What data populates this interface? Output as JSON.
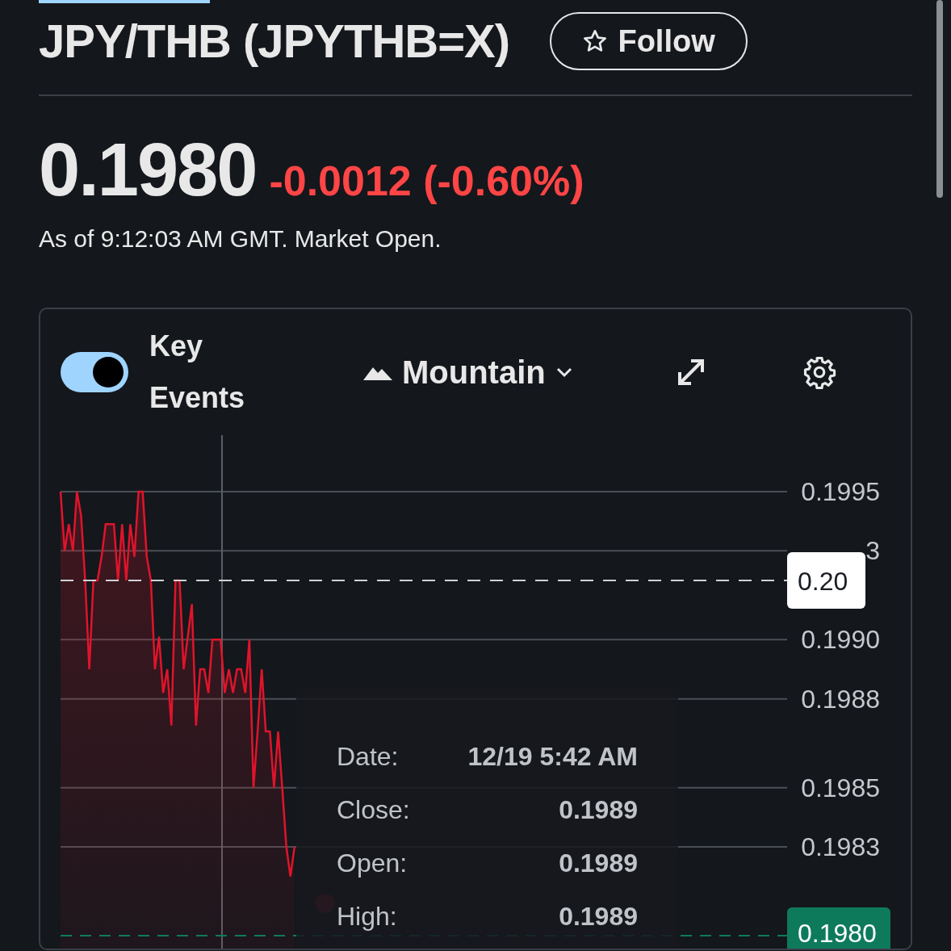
{
  "header": {
    "title": "JPY/THB (JPYTHB=X)",
    "follow_button": "Follow"
  },
  "quote": {
    "price": "0.1980",
    "change": "-0.0012 (-0.60%)",
    "timestamp": "As of 9:12:03 AM GMT. Market Open."
  },
  "chart_controls": {
    "key_events": {
      "label": "Key Events",
      "on": true
    },
    "chart_type": "Mountain"
  },
  "chart": {
    "covered_tick_fragment": "3",
    "chart_data": {
      "type": "area",
      "grid": true,
      "ylim": [
        0.198,
        0.1995
      ],
      "yticks": [
        0.1995,
        {
          "value": 0.199,
          "label": "0.1990"
        },
        0.1988,
        0.1985,
        0.1983
      ],
      "series": [
        {
          "color": "#e0142b",
          "values": [
            0.1995,
            0.1993,
            0.19939,
            0.1993,
            0.1995,
            0.19942,
            0.1992,
            0.1989,
            0.1992,
            0.1992,
            0.19928,
            0.19939,
            0.19939,
            0.19939,
            0.1992,
            0.19939,
            0.1992,
            0.19939,
            0.19928,
            0.1995,
            0.1995,
            0.19928,
            0.1992,
            0.1989,
            0.19901,
            0.19882,
            0.1989,
            0.19871,
            0.1992,
            0.1992,
            0.1989,
            0.19901,
            0.19912,
            0.19871,
            0.1989,
            0.1989,
            0.19882,
            0.199,
            0.199,
            0.199,
            0.19882,
            0.1989,
            0.19882,
            0.1989,
            0.1989,
            0.19882,
            0.199,
            0.1985,
            0.19869,
            0.1989,
            0.19869,
            0.19869,
            0.1985,
            0.19869,
            0.1985,
            0.1983,
            0.1982,
            0.1983,
            null,
            null,
            null,
            null,
            null,
            null,
            null,
            null,
            null,
            null,
            null,
            null,
            null,
            null,
            null,
            null,
            null,
            null,
            null,
            null,
            null,
            null,
            null,
            null,
            null,
            null,
            null,
            null,
            null,
            null,
            null,
            null,
            null,
            null,
            null,
            null,
            null,
            null,
            null,
            null,
            null,
            null,
            null,
            null,
            null,
            null,
            null,
            null,
            null,
            null,
            null,
            null,
            null,
            null,
            null,
            null,
            null,
            null,
            null,
            null,
            null,
            null,
            null,
            null,
            null,
            null,
            null,
            null,
            null,
            null,
            null,
            null,
            null,
            null,
            null,
            null,
            null,
            null,
            null,
            null,
            null,
            null,
            null,
            null,
            null,
            null,
            null,
            null,
            null,
            null,
            null,
            null,
            null,
            null,
            null,
            null,
            null,
            null,
            null,
            null,
            null,
            null,
            null,
            null,
            null,
            null,
            null,
            null,
            null,
            null,
            null,
            null,
            null,
            null,
            null,
            null,
            null,
            null,
            null,
            null
          ]
        }
      ],
      "ref_lines": [
        {
          "axis": "y",
          "value": 0.1992,
          "label": "0.20",
          "color": "#d0d3d6"
        },
        {
          "axis": "y",
          "value": 0.198,
          "label": "0.1980",
          "color": "#0e7a5c"
        }
      ]
    },
    "tooltip": [
      {
        "label": "Date:",
        "value": "12/19 5:42 AM"
      },
      {
        "label": "Close:",
        "value": "0.1989"
      },
      {
        "label": "Open:",
        "value": "0.1989"
      },
      {
        "label": "High:",
        "value": "0.1989"
      }
    ]
  }
}
